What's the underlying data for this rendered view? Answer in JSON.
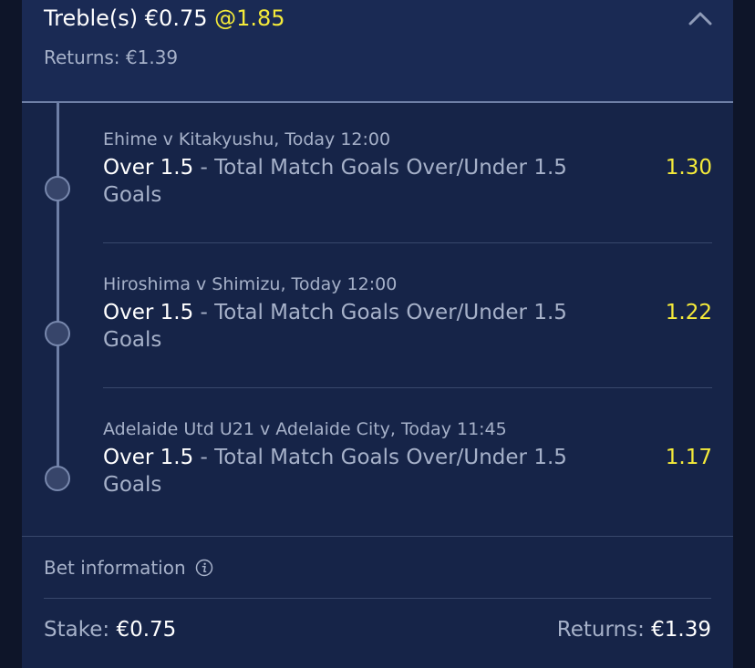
{
  "header": {
    "bet_type": "Treble(s)",
    "stake": "€0.75",
    "odds": "@1.85",
    "returns_label": "Returns:",
    "returns_value": "€1.39",
    "collapse_icon": "chevron-up-icon"
  },
  "selections": [
    {
      "event": "Ehime v Kitakyushu, Today 12:00",
      "name": "Over 1.5",
      "market": " - Total Match Goals Over/Under 1.5 Goals",
      "odds": "1.30"
    },
    {
      "event": "Hiroshima v Shimizu, Today 12:00",
      "name": "Over 1.5",
      "market": " - Total Match Goals Over/Under 1.5 Goals",
      "odds": "1.22"
    },
    {
      "event": "Adelaide Utd U21 v Adelaide City, Today 11:45",
      "name": "Over 1.5",
      "market": " - Total Match Goals Over/Under 1.5 Goals",
      "odds": "1.17"
    }
  ],
  "bet_info": {
    "label": "Bet information",
    "icon": "info-icon"
  },
  "footer": {
    "stake_label": "Stake:",
    "stake_value": "€0.75",
    "returns_label": "Returns:",
    "returns_value": "€1.39"
  },
  "colors": {
    "background": "#162448",
    "header_background": "#1a2a54",
    "odds_highlight": "#f4ea3a",
    "muted_text": "#a6b1c9"
  }
}
